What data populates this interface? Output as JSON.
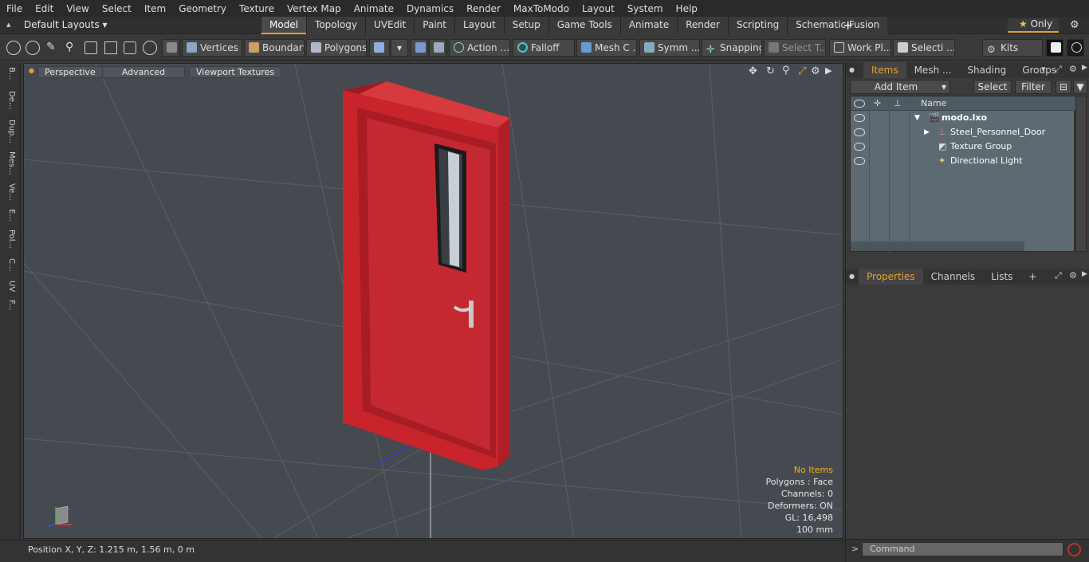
{
  "menu": [
    "File",
    "Edit",
    "View",
    "Select",
    "Item",
    "Geometry",
    "Texture",
    "Vertex Map",
    "Animate",
    "Dynamics",
    "Render",
    "MaxToModo",
    "Layout",
    "System",
    "Help"
  ],
  "layout_selector": "Default Layouts",
  "tabs": [
    "Model",
    "Topology",
    "UVEdit",
    "Paint",
    "Layout",
    "Setup",
    "Game Tools",
    "Animate",
    "Render",
    "Scripting",
    "Schematic Fusion"
  ],
  "active_tab": "Model",
  "only_label": "Only",
  "toolbar": {
    "vertices": "Vertices",
    "boundary": "Boundary",
    "polygons": "Polygons",
    "action": "Action",
    "falloff": "Falloff",
    "mesh_c": "Mesh C ...",
    "symm": "Symm ...",
    "snapping": "Snapping",
    "select_t": "Select T...",
    "work_pl": "Work Pl...",
    "selecti": "Selecti ...",
    "kits": "Kits"
  },
  "left_tabs": [
    "B...",
    "De...",
    "Dup...",
    "Mes...",
    "Ve...",
    "E...",
    "Pol...",
    "C...",
    "UV",
    "F..."
  ],
  "viewport": {
    "perspective": "Perspective",
    "advanced": "Advanced",
    "viewport_textures": "Viewport Textures",
    "info": {
      "items": "No Items",
      "polygons": "Polygons : Face",
      "channels": "Channels: 0",
      "deformers": "Deformers: ON",
      "gl": "GL: 16,498",
      "unit": "100 mm"
    },
    "door_color": "#c8242c"
  },
  "status": {
    "position": "Position X, Y, Z:   1.215 m, 1.56 m, 0 m"
  },
  "right_panel": {
    "tabs_top": [
      "Items",
      "Mesh ...",
      "Shading",
      "Groups"
    ],
    "add_item": "Add Item",
    "select": "Select",
    "filter": "Filter",
    "column_name": "Name",
    "tree": [
      {
        "label": "modo.lxo",
        "bold": true
      },
      {
        "label": "Steel_Personnel_Door",
        "bold": false
      },
      {
        "label": "Texture Group",
        "bold": false
      },
      {
        "label": "Directional Light",
        "bold": false
      }
    ],
    "tabs_bottom": [
      "Properties",
      "Channels",
      "Lists"
    ],
    "command_placeholder": "Command"
  },
  "colors": {
    "accent": "#e8a030",
    "list_bg": "#5d6a72"
  }
}
